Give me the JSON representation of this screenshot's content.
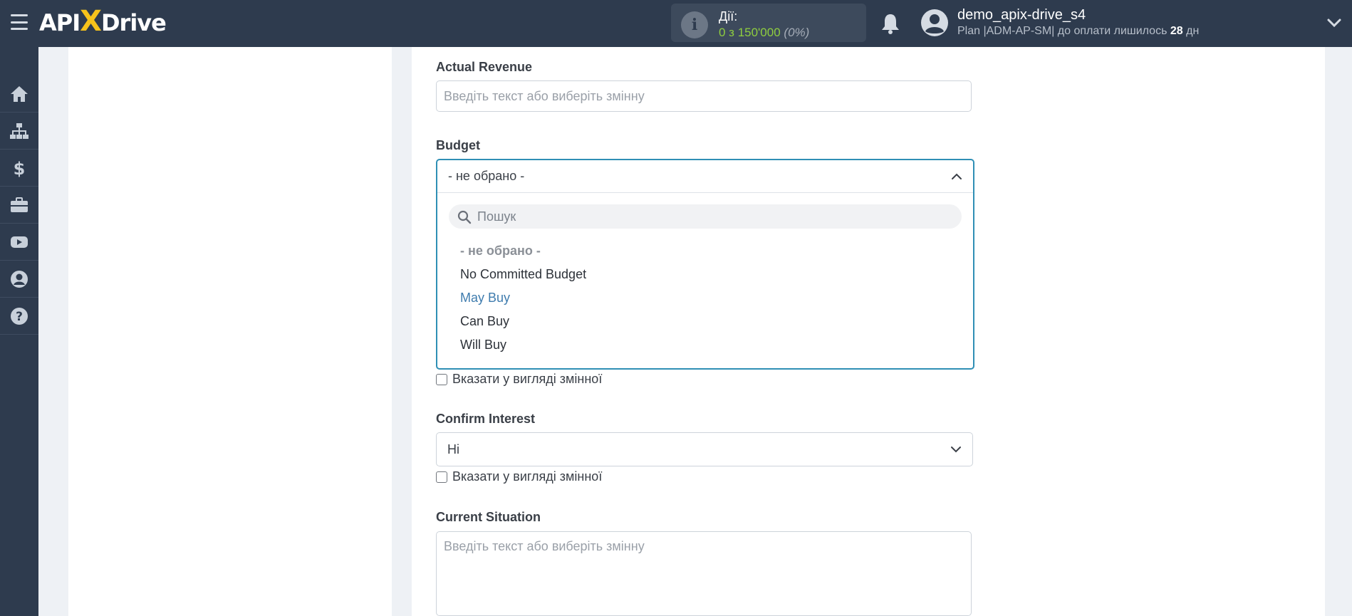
{
  "header": {
    "logo_api": "API",
    "logo_x": "X",
    "logo_drive": "Drive",
    "actions_label": "Дії:",
    "actions_count": "0 з 150'000",
    "actions_percent": "(0%)",
    "user_name": "demo_apix-drive_s4",
    "plan_text": "Plan |ADM-AP-SM| до оплати лишилось",
    "plan_days": "28",
    "plan_days_unit": "дн"
  },
  "sidebar": {
    "items": [
      {
        "icon": "home-icon"
      },
      {
        "icon": "sitemap-icon"
      },
      {
        "icon": "dollar-icon"
      },
      {
        "icon": "briefcase-icon"
      },
      {
        "icon": "youtube-icon"
      },
      {
        "icon": "user-circle-icon"
      },
      {
        "icon": "help-icon"
      }
    ]
  },
  "form": {
    "actual_revenue": {
      "label": "Actual Revenue",
      "placeholder": "Введіть текст або виберіть змінну"
    },
    "budget": {
      "label": "Budget",
      "selected": "- не обрано -",
      "search_placeholder": "Пошук",
      "options": [
        "- не обрано -",
        "No Committed Budget",
        "May Buy",
        "Can Buy",
        "Will Buy"
      ],
      "highlighted_index": 2
    },
    "budget_as_variable": "Вказати у вигляді змінної",
    "confirm_interest": {
      "label": "Confirm Interest",
      "selected": "Ні"
    },
    "confirm_as_variable": "Вказати у вигляді змінної",
    "current_situation": {
      "label": "Current Situation",
      "placeholder": "Введіть текст або виберіть змінну"
    }
  },
  "colors": {
    "topbar": "#2e3b4e",
    "accent_border": "#2f8fb5",
    "logo_x": "#f7c31b",
    "count_green": "#8fce3f",
    "highlight_option": "#3f7cae"
  }
}
